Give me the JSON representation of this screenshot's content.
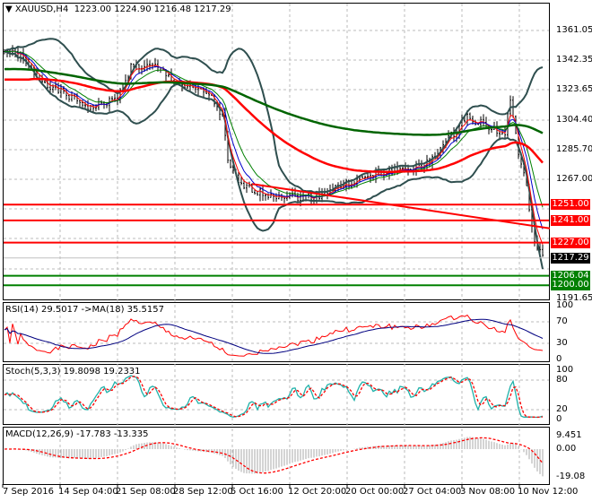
{
  "header": {
    "symbol": "XAUUSD,H4",
    "ohlc": "1223.00 1224.90 1216.48 1217.29"
  },
  "main_axis": [
    "1361.05",
    "1342.35",
    "1323.65",
    "1304.40",
    "1285.70",
    "1267.00",
    "1191.65"
  ],
  "levels": [
    {
      "price": 1251.0,
      "label": "1251.00",
      "color": "#ff0000"
    },
    {
      "price": 1241.0,
      "label": "1241.00",
      "color": "#ff0000"
    },
    {
      "price": 1227.0,
      "label": "1227.00",
      "color": "#ff0000"
    },
    {
      "price": 1206.04,
      "label": "1206.04",
      "color": "#008000"
    },
    {
      "price": 1200.0,
      "label": "1200.00",
      "color": "#008000"
    }
  ],
  "current": {
    "price": 1217.29,
    "label": "1217.29"
  },
  "rsi": {
    "title": "RSI(14) 29.5017  ->MA(18) 35.5157",
    "axis": [
      "100",
      "70",
      "30",
      "0"
    ]
  },
  "stoch": {
    "title": "Stoch(5,3,3) 19.8098 19.2331",
    "axis": [
      "100",
      "80",
      "20",
      "0"
    ]
  },
  "macd": {
    "title": "MACD(12,26,9) -17.783 -13.335",
    "axis": [
      "9.451",
      "0.00",
      "-19.08"
    ]
  },
  "time_labels": [
    "7 Sep 2016",
    "14 Sep 04:00",
    "21 Sep 08:00",
    "28 Sep 12:00",
    "5 Oct 16:00",
    "12 Oct 20:00",
    "20 Oct 00:00",
    "27 Oct 04:00",
    "3 Nov 08:00",
    "10 Nov 12:00"
  ],
  "colors": {
    "bull": "#000000",
    "bands": "#2f4f4f",
    "ma_long": "#006400",
    "ma_mid": "#ff0000",
    "rsi": "#ff0000",
    "rsi_ma": "#000080",
    "stoch_main": "#20b2aa",
    "stoch_signal": "#ff0000"
  },
  "chart_data": {
    "type": "candlestick",
    "price_range": [
      1191.65,
      1370
    ],
    "waypoints": [
      [
        0,
        1349
      ],
      [
        6,
        1345
      ],
      [
        12,
        1332
      ],
      [
        19,
        1324
      ],
      [
        32,
        1312
      ],
      [
        42,
        1318
      ],
      [
        47,
        1338
      ],
      [
        56,
        1338
      ],
      [
        66,
        1326
      ],
      [
        76,
        1321
      ],
      [
        81,
        1307
      ],
      [
        83,
        1278
      ],
      [
        87,
        1264
      ],
      [
        96,
        1258
      ],
      [
        109,
        1256
      ],
      [
        116,
        1256
      ],
      [
        122,
        1261
      ],
      [
        132,
        1267
      ],
      [
        146,
        1273
      ],
      [
        156,
        1275
      ],
      [
        164,
        1290
      ],
      [
        172,
        1307
      ],
      [
        179,
        1301
      ],
      [
        186,
        1295
      ],
      [
        188,
        1318
      ],
      [
        191,
        1284
      ],
      [
        194,
        1261
      ],
      [
        197,
        1227
      ],
      [
        200,
        1217
      ]
    ],
    "trendline": [
      [
        92,
        1264
      ],
      [
        203,
        1236
      ]
    ]
  }
}
